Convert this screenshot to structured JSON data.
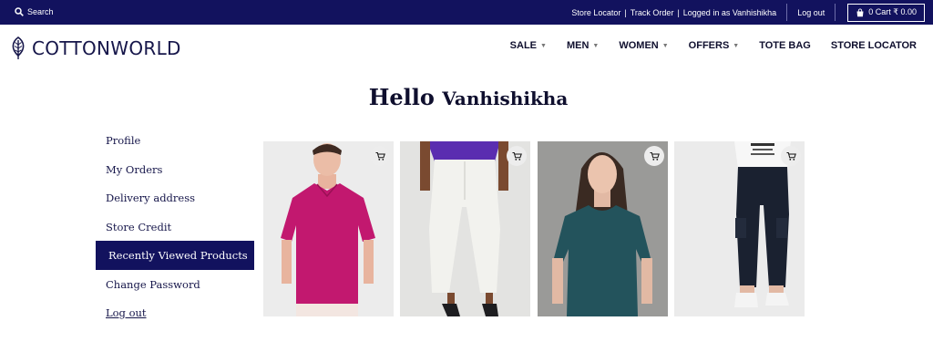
{
  "topbar": {
    "search_label": "Search",
    "store_locator": "Store Locator",
    "track_order": "Track Order",
    "separator": "|",
    "logged_in": "Logged in as Vanhishikha",
    "logout": "Log out",
    "cart_label": "0 Cart ₹ 0.00"
  },
  "header": {
    "logo_text": "COTTONWORLD",
    "nav": [
      {
        "label": "SALE",
        "has_dropdown": true
      },
      {
        "label": "MEN",
        "has_dropdown": true
      },
      {
        "label": "WOMEN",
        "has_dropdown": true
      },
      {
        "label": "OFFERS",
        "has_dropdown": true
      },
      {
        "label": "TOTE BAG",
        "has_dropdown": false
      },
      {
        "label": "STORE LOCATOR",
        "has_dropdown": false
      }
    ]
  },
  "greeting": {
    "hello": "Hello",
    "name": "Vanhishikha"
  },
  "sidebar": {
    "items": [
      {
        "label": "Profile"
      },
      {
        "label": "My Orders"
      },
      {
        "label": "Delivery address"
      },
      {
        "label": "Store Credit"
      },
      {
        "label": "Recently Viewed Products",
        "active": true
      },
      {
        "label": "Change Password"
      },
      {
        "label": "Log out"
      }
    ]
  },
  "products": [
    {
      "icon": "add-to-cart-icon",
      "garment_color": "#c2186f"
    },
    {
      "icon": "add-to-cart-icon",
      "garment_color": "#f2f2ee"
    },
    {
      "icon": "add-to-cart-icon",
      "garment_color": "#23535c"
    },
    {
      "icon": "add-to-cart-icon",
      "garment_color": "#1a2130"
    }
  ],
  "colors": {
    "brand_navy": "#12125e",
    "text_navy": "#16164a"
  }
}
